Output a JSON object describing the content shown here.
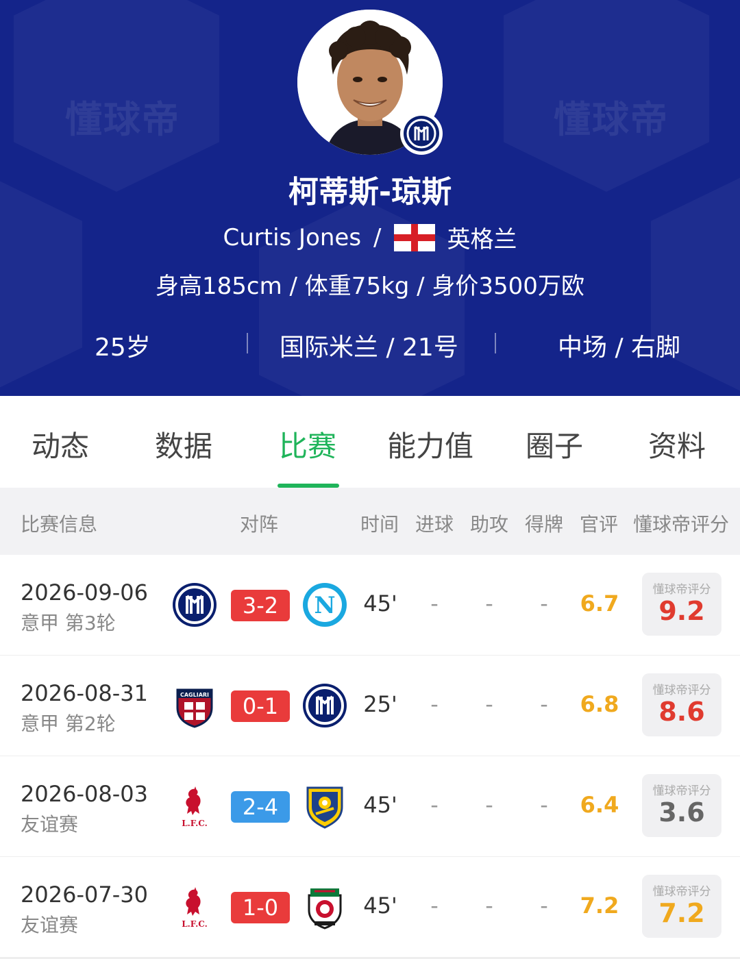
{
  "header": {
    "watermark": "懂球帝",
    "name_cn": "柯蒂斯-琼斯",
    "name_en": "Curtis Jones",
    "separator": "/",
    "nationality": "英格兰",
    "stats": "身高185cm / 体重75kg / 身价3500万欧",
    "age": "25岁",
    "club_number": "国际米兰 / 21号",
    "position_foot": "中场 / 右脚"
  },
  "tabs": [
    {
      "label": "动态"
    },
    {
      "label": "数据"
    },
    {
      "label": "比赛"
    },
    {
      "label": "能力值"
    },
    {
      "label": "圈子"
    },
    {
      "label": "资料"
    }
  ],
  "active_tab": "比赛",
  "columns": [
    "比赛信息",
    "对阵",
    "时间",
    "进球",
    "助攻",
    "得牌",
    "官评",
    "懂球帝评分"
  ],
  "rating_label": "懂球帝评分",
  "matches": [
    {
      "date": "2026-09-06",
      "competition": "意甲 第3轮",
      "home_icon": "inter-milan-icon",
      "away_icon": "napoli-icon",
      "score": "3-2",
      "score_color": "#e93b3b",
      "minutes": "45'",
      "goals": "-",
      "assists": "-",
      "cards": "-",
      "official": "6.7",
      "rating": "9.2",
      "rating_color": "#e03b2f"
    },
    {
      "date": "2026-08-31",
      "competition": "意甲 第2轮",
      "home_icon": "cagliari-icon",
      "away_icon": "inter-milan-icon",
      "score": "0-1",
      "score_color": "#e93b3b",
      "minutes": "25'",
      "goals": "-",
      "assists": "-",
      "cards": "-",
      "official": "6.8",
      "rating": "8.6",
      "rating_color": "#e03b2f"
    },
    {
      "date": "2026-08-03",
      "competition": "友谊赛",
      "home_icon": "liverpool-icon",
      "away_icon": "leeds-united-icon",
      "score": "2-4",
      "score_color": "#3b9ae8",
      "minutes": "45'",
      "goals": "-",
      "assists": "-",
      "cards": "-",
      "official": "6.4",
      "rating": "3.6",
      "rating_color": "#666666"
    },
    {
      "date": "2026-07-30",
      "competition": "友谊赛",
      "home_icon": "liverpool-icon",
      "away_icon": "wrexham-icon",
      "score": "1-0",
      "score_color": "#e93b3b",
      "minutes": "45'",
      "goals": "-",
      "assists": "-",
      "cards": "-",
      "official": "7.2",
      "rating": "7.2",
      "rating_color": "#f0a91e"
    }
  ],
  "colors": {
    "header_bg": "#14248a",
    "accent_green": "#1fb45a",
    "official_rating": "#f0a91e",
    "win_red": "#e93b3b",
    "loss_blue": "#3b9ae8"
  }
}
